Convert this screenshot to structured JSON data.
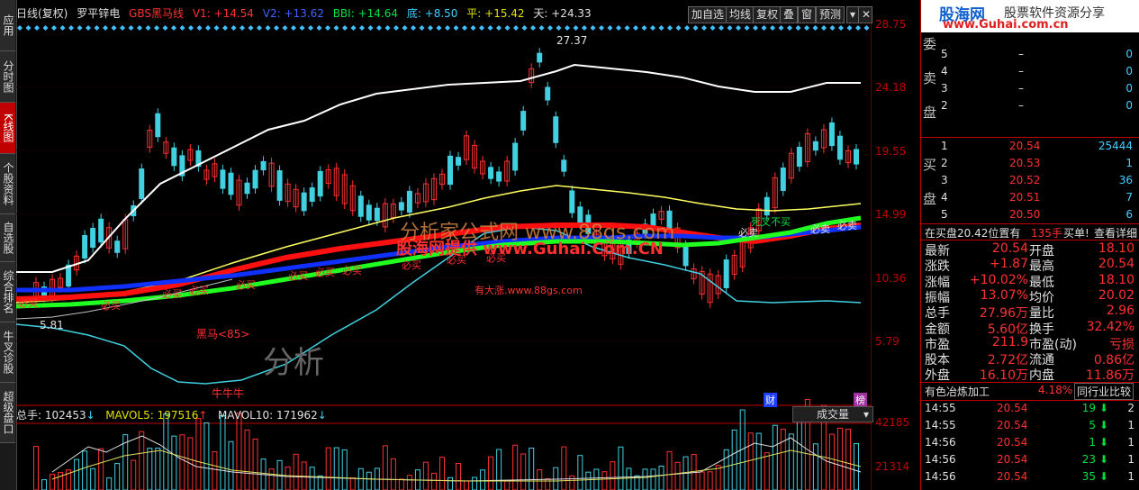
{
  "nav": [
    "应用",
    "分时图",
    "K线图",
    "个股资料",
    "自选股",
    "综合排名",
    "牛叉诊股",
    "超级盘口"
  ],
  "info": {
    "period": "日线(复权)",
    "stock": "罗平锌电",
    "gbs": "GBS黑马线",
    "v1": "V1: +14.54",
    "v2": "V2: +13.62",
    "bbi": "BBI: +14.64",
    "di": "底: +8.50",
    "ping": "平: +15.42",
    "tian": "天: +24.33"
  },
  "toolbar": [
    "加自选",
    "均线",
    "复权",
    "叠",
    "窗",
    "预测"
  ],
  "y_axis": [
    "28.75",
    "24.18",
    "19.55",
    "14.99",
    "10.36",
    "5.79"
  ],
  "vol_axis": [
    "42185",
    "21314"
  ],
  "chart_labels": {
    "high": "27.37",
    "low": "5.81",
    "heima": "黑马<85>",
    "niuniuniu": "牛牛牛",
    "cai": "财",
    "bang": "榜",
    "youdazhang": "有大涨.www.88gs.com",
    "sicha": "死叉不买",
    "buy": "必买",
    "sell": "必卖",
    "watermark1": "分析家公式网 www.88gs.com",
    "watermark2": "股海网提供 www.Guhai.Com.CN",
    "fenxi": "分析"
  },
  "volume": {
    "total": "总手: 102453",
    "mavol5": "MAVOL5: 197516",
    "mavol10": "MAVOL10: 171962",
    "select": "成交量"
  },
  "logo": {
    "name": "股海网",
    "slogan": "股票软件资源分享",
    "url": "www.Guhai.com.cn"
  },
  "order_book": {
    "sell_label": [
      "委",
      "卖",
      "盘"
    ],
    "buy_label": [
      "买",
      "盘"
    ],
    "sell": [
      {
        "n": "5",
        "price": "–",
        "vol": "0"
      },
      {
        "n": "4",
        "price": "–",
        "vol": "0"
      },
      {
        "n": "3",
        "price": "–",
        "vol": "0"
      },
      {
        "n": "2",
        "price": "–",
        "vol": "0"
      }
    ],
    "buy": [
      {
        "n": "1",
        "price": "20.54",
        "vol": "25444"
      },
      {
        "n": "2",
        "price": "20.53",
        "vol": "1"
      },
      {
        "n": "3",
        "price": "20.52",
        "vol": "36"
      },
      {
        "n": "4",
        "price": "20.51",
        "vol": "7"
      },
      {
        "n": "5",
        "price": "20.50",
        "vol": "6"
      }
    ]
  },
  "status_line": {
    "a": "在买盘20.42位置有",
    "b": "135手",
    "c": "买单!",
    "d": "查看详细"
  },
  "quote": [
    {
      "k1": "最新",
      "v1": "20.54",
      "k2": "开盘",
      "v2": "18.10"
    },
    {
      "k1": "涨跌",
      "v1": "+1.87",
      "k2": "最高",
      "v2": "20.54"
    },
    {
      "k1": "涨幅",
      "v1": "+10.02%",
      "k2": "最低",
      "v2": "18.10"
    },
    {
      "k1": "振幅",
      "v1": "13.07%",
      "k2": "均价",
      "v2": "20.02"
    },
    {
      "k1": "总手",
      "v1": "27.96万",
      "k2": "量比",
      "v2": "2.96"
    },
    {
      "k1": "金额",
      "v1": "5.60亿",
      "k2": "换手",
      "v2": "32.42%"
    },
    {
      "k1": "市盈",
      "v1": "211.9",
      "k2": "市盈(动)",
      "v2": "亏损"
    },
    {
      "k1": "股本",
      "v1": "2.72亿",
      "k2": "流通",
      "v2": "0.86亿"
    },
    {
      "k1": "外盘",
      "v1": "16.10万",
      "k2": "内盘",
      "v2": "11.86万"
    }
  ],
  "industry": {
    "name": "有色冶炼加工",
    "pct": "4.18%",
    "btn": "同行业比较"
  },
  "ticks": [
    {
      "t": "14:55",
      "p": "20.54",
      "v": "19",
      "n": "2"
    },
    {
      "t": "14:55",
      "p": "20.54",
      "v": "5",
      "n": "1"
    },
    {
      "t": "14:56",
      "p": "20.54",
      "v": "1",
      "n": "1"
    },
    {
      "t": "14:56",
      "p": "20.54",
      "v": "23",
      "n": "1"
    },
    {
      "t": "14:56",
      "p": "20.54",
      "v": "35",
      "n": "1"
    }
  ]
}
